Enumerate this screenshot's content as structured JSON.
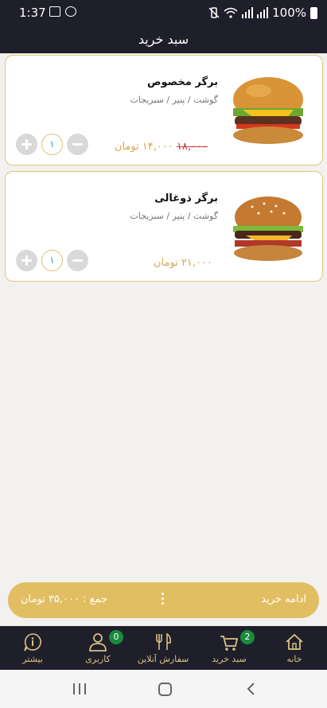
{
  "status_bar": {
    "time": "1:37",
    "battery": "100%"
  },
  "header": {
    "title": "سبد خرید"
  },
  "cart_items": [
    {
      "name": "برگر مخصوص",
      "description": "گوشت / پنیر / سبزیجات",
      "old_price": "۱۸,۰۰۰",
      "price": "۱۴,۰۰۰ تومان",
      "quantity": "۱"
    },
    {
      "name": "برگر ذوغالی",
      "description": "گوشت / پنیر / سبزیجات",
      "price": "۲۱,۰۰۰ تومان",
      "quantity": "۱"
    }
  ],
  "total_bar": {
    "total": "جمع : ۳۵,۰۰۰ تومان",
    "continue_label": "ادامه خرید"
  },
  "bottom_nav": {
    "items": [
      {
        "label": "خانه",
        "icon": "home-icon"
      },
      {
        "label": "سبد خرید",
        "icon": "cart-icon",
        "badge": "2"
      },
      {
        "label": "سفارش آنلاین",
        "icon": "fork-knife-icon"
      },
      {
        "label": "کاربری",
        "icon": "user-icon",
        "badge": "0"
      },
      {
        "label": "بیشتر",
        "icon": "info-icon"
      }
    ]
  },
  "colors": {
    "accent": "#e2be62",
    "dark": "#1f1f2b",
    "badge": "#1a8a3b",
    "old_price": "#c43b3b"
  }
}
